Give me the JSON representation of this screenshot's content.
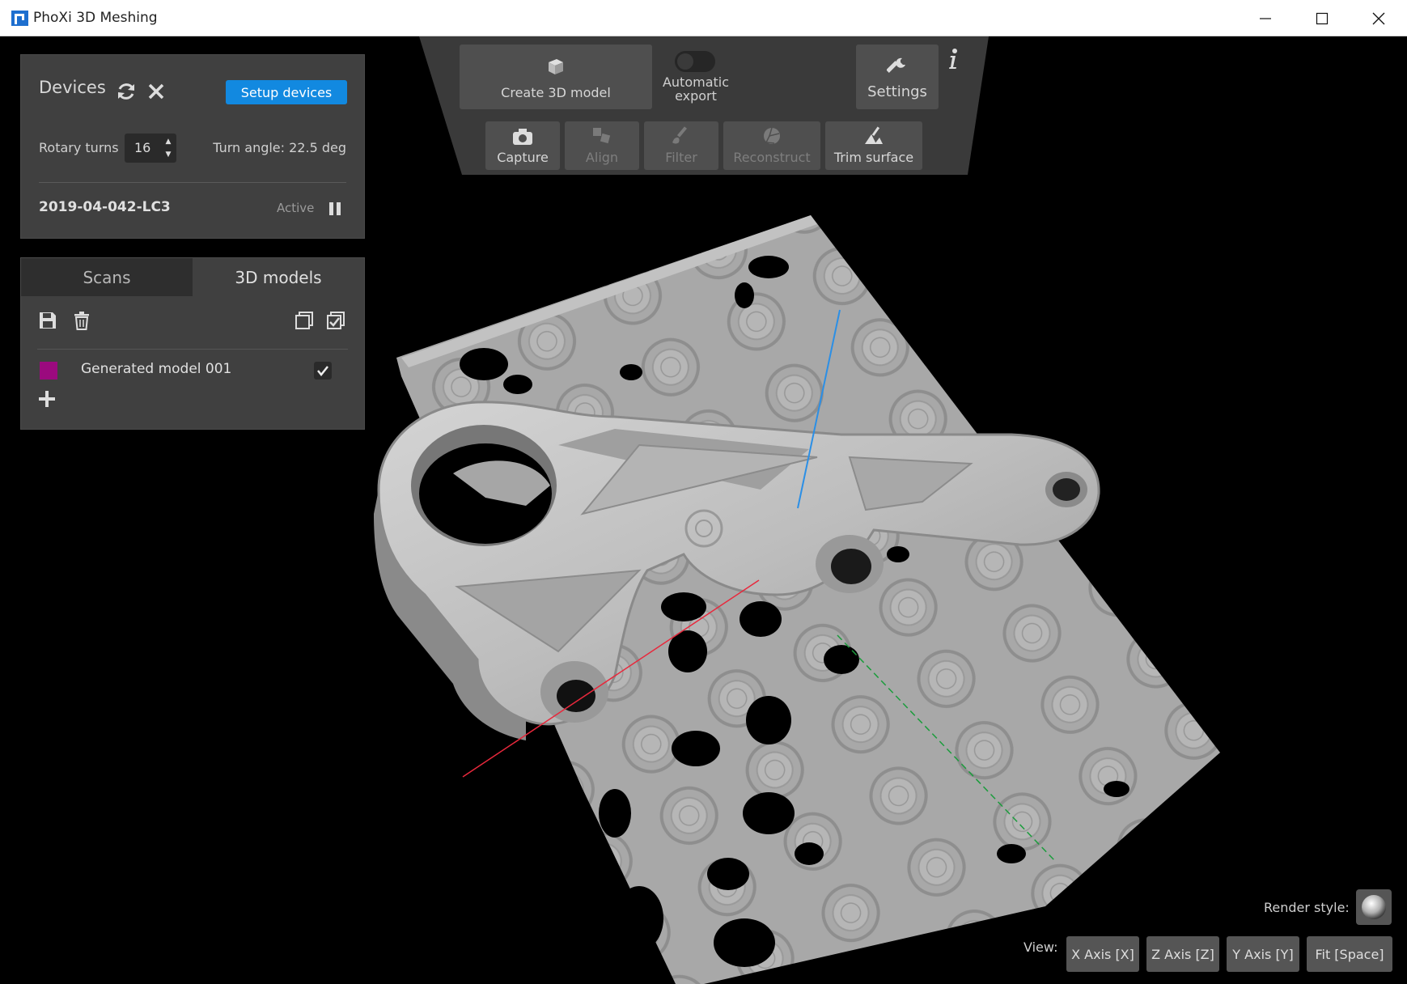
{
  "window": {
    "title": "PhoXi 3D Meshing",
    "minimize": "—",
    "maximize": "☐",
    "close": "✕"
  },
  "devices": {
    "title": "Devices",
    "refresh_icon": "refresh-icon",
    "close_icon": "close-icon",
    "setup_label": "Setup devices",
    "rotary_label": "Rotary turns",
    "rotary_value": "16",
    "turn_angle": "Turn angle: 22.5 deg",
    "device_id": "2019-04-042-LC3",
    "status": "Active",
    "pause_icon": "pause-icon",
    "accent": "#1289e0"
  },
  "models_panel": {
    "tabs": [
      "Scans",
      "3D models"
    ],
    "active_tab": "3D models",
    "tools": [
      "save-icon",
      "delete-icon",
      "copy-icon",
      "select-all-icon"
    ],
    "models": [
      {
        "name": "Generated model 001",
        "color": "#9b0a7e",
        "checked": true
      }
    ],
    "add_icon": "plus-icon"
  },
  "toolbar": {
    "create_label": "Create 3D model",
    "auto_export_label": "Automatic export",
    "auto_export_on": false,
    "settings_label": "Settings",
    "info_icon": "info-icon",
    "steps": [
      {
        "label": "Capture",
        "icon": "camera-icon",
        "enabled": true
      },
      {
        "label": "Align",
        "icon": "align-icon",
        "enabled": false
      },
      {
        "label": "Filter",
        "icon": "brush-icon",
        "enabled": false
      },
      {
        "label": "Reconstruct",
        "icon": "reconstruct-icon",
        "enabled": false
      },
      {
        "label": "Trim surface",
        "icon": "trim-icon",
        "enabled": true
      }
    ]
  },
  "viewport": {
    "render_style_label": "Render style:",
    "view_label": "View:",
    "view_buttons": [
      "X Axis [X]",
      "Z Axis [Z]",
      "Y Axis [Y]",
      "Fit [Space]"
    ],
    "axis_colors": {
      "x": "#e8283c",
      "y": "#1b9c3c",
      "z": "#2b8fe6"
    }
  }
}
